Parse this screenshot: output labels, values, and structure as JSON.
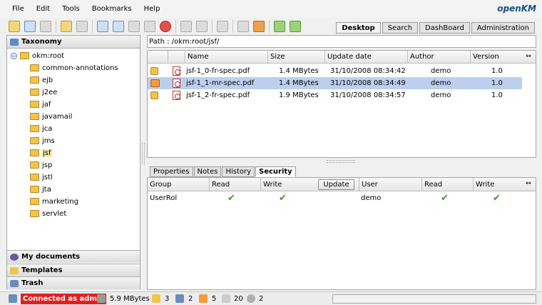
{
  "menu": [
    "File",
    "Edit",
    "Tools",
    "Bookmarks",
    "Help"
  ],
  "logo": {
    "main": "penKM",
    "prefix": "o"
  },
  "top_tabs": [
    {
      "label": "Desktop",
      "active": true
    },
    {
      "label": "Search",
      "active": false
    },
    {
      "label": "DashBoard",
      "active": false
    },
    {
      "label": "Administration",
      "active": false
    }
  ],
  "left": {
    "taxonomy_label": "Taxonomy",
    "root": "okm:root",
    "folders": [
      "common-annotations",
      "ejb",
      "j2ee",
      "jaf",
      "javamail",
      "jca",
      "jms",
      "jsf",
      "jsp",
      "jstl",
      "jta",
      "marketing",
      "servlet"
    ],
    "selected_folder": "jsf",
    "my_documents_label": "My documents",
    "templates_label": "Templates",
    "trash_label": "Trash"
  },
  "path": {
    "label": "Path :",
    "value": "/okm:root/jsf/"
  },
  "files": {
    "columns": [
      "Name",
      "Size",
      "Update date",
      "Author",
      "Version"
    ],
    "rows": [
      {
        "name": "jsf-1_0-fr-spec.pdf",
        "size": "1.4 MBytes",
        "date": "31/10/2008 08:34:42",
        "author": "demo",
        "version": "1.0",
        "status_icon": "lock-icon",
        "selected": false
      },
      {
        "name": "jsf-1_1-mr-spec.pdf",
        "size": "1.4 MBytes",
        "date": "31/10/2008 08:34:49",
        "author": "demo",
        "version": "1.0",
        "status_icon": "mail-icon",
        "selected": true
      },
      {
        "name": "jsf-1_2-fr-spec.pdf",
        "size": "1.9 MBytes",
        "date": "31/10/2008 08:34:57",
        "author": "demo",
        "version": "1.0",
        "status_icon": "lock-icon",
        "selected": false
      }
    ]
  },
  "bottom_tabs": [
    {
      "label": "Properties",
      "active": false
    },
    {
      "label": "Notes",
      "active": false
    },
    {
      "label": "History",
      "active": false
    },
    {
      "label": "Security",
      "active": true
    }
  ],
  "security": {
    "group_columns": [
      "Group",
      "Read",
      "Write"
    ],
    "update_label": "Update",
    "user_columns": [
      "User",
      "Read",
      "Write"
    ],
    "group_row": {
      "name": "UserRol",
      "read": true,
      "write": true
    },
    "user_row": {
      "name": "demo",
      "read": true,
      "write": true
    }
  },
  "status": {
    "connected": "Connected as admin",
    "size": "5.9 MBytes",
    "locked": "3",
    "checkout": "2",
    "subscribed": "5",
    "mails": "20",
    "workflows": "2"
  },
  "colors": {
    "accent": "#1b4f8a",
    "selection": "#bcd0ee",
    "connected_bg": "#e02020"
  }
}
